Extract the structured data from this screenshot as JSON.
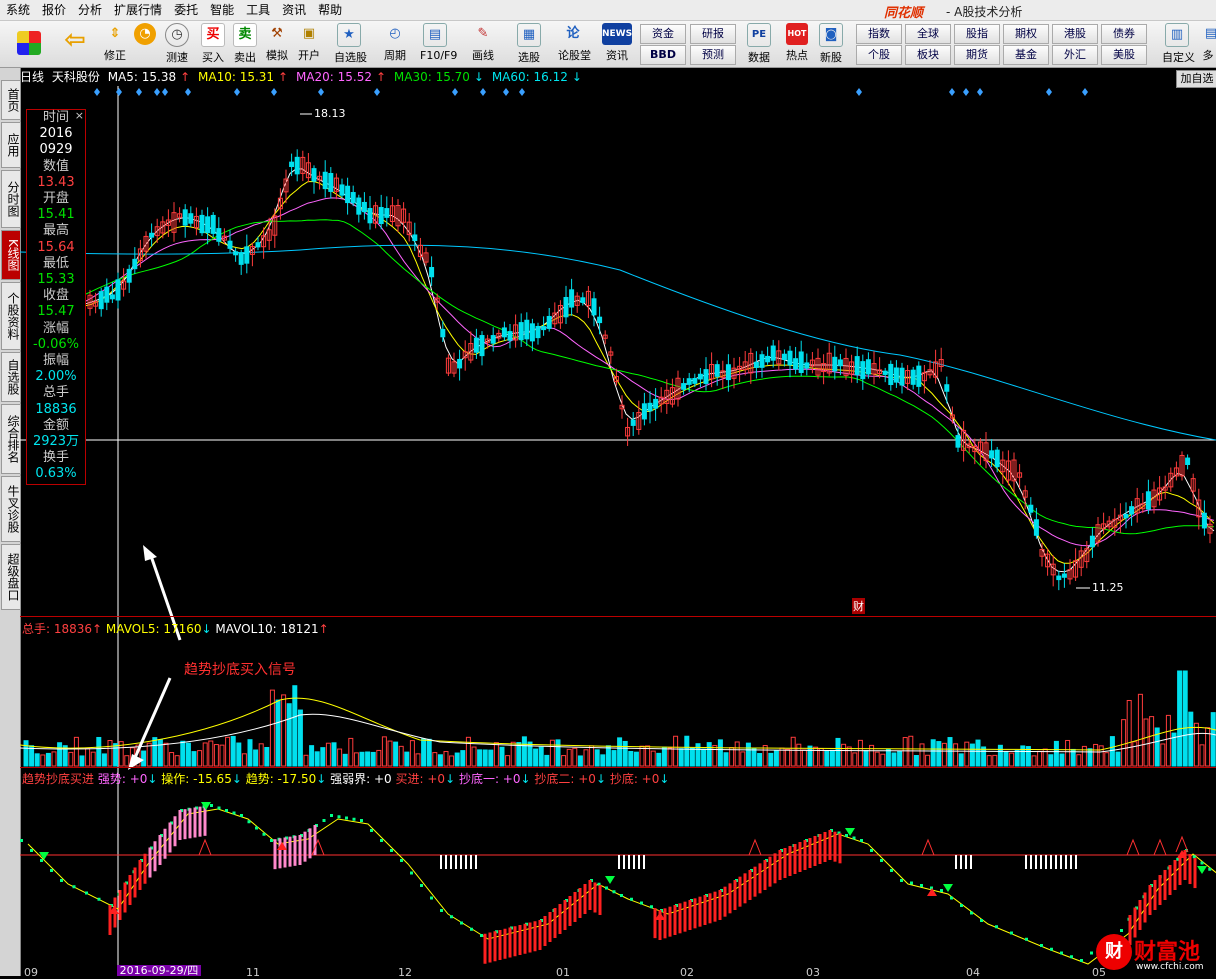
{
  "menu": [
    "系统",
    "报价",
    "分析",
    "扩展行情",
    "委托",
    "智能",
    "工具",
    "资讯",
    "帮助"
  ],
  "brand": "同花顺",
  "app_title": "- A股技术分析",
  "toolbar": {
    "buttons": [
      {
        "label": "",
        "icon": "grid-icon"
      },
      {
        "label": "",
        "icon": "back-arrow-icon"
      },
      {
        "label": "修正",
        "icon": "up-down-arrow-icon"
      },
      {
        "label": "测速",
        "icon": "clock-icon"
      },
      {
        "label": "买入",
        "icon": "buy-icon",
        "glyph": "买"
      },
      {
        "label": "卖出",
        "icon": "sell-icon",
        "glyph": "卖"
      },
      {
        "label": "模拟",
        "icon": "hammer-icon"
      },
      {
        "label": "开户",
        "icon": "lock-icon"
      },
      {
        "label": "自选股",
        "icon": "star-icon"
      },
      {
        "label": "周期",
        "icon": "cycle-icon"
      },
      {
        "label": "F10/F9",
        "icon": "f10-icon"
      },
      {
        "label": "画线",
        "icon": "pen-icon"
      },
      {
        "label": "选股",
        "icon": "screen-icon"
      },
      {
        "label": "论股堂",
        "icon": "forum-icon"
      },
      {
        "label": "资讯",
        "icon": "news-icon",
        "glyph": "NEWS"
      },
      {
        "label": "数据",
        "icon": "pe-icon",
        "glyph": "PE"
      },
      {
        "label": "热点",
        "icon": "hot-icon",
        "glyph": "HOT"
      },
      {
        "label": "新股",
        "icon": "new-stock-icon"
      },
      {
        "label": "自定义",
        "icon": "custom-icon"
      },
      {
        "label": "多",
        "icon": "more-icon"
      }
    ],
    "small": [
      "资金",
      "BBD",
      "研报",
      "预测",
      "指数",
      "个股",
      "全球",
      "板块",
      "股指",
      "期货",
      "期权",
      "基金",
      "港股",
      "外汇",
      "债券",
      "美股"
    ]
  },
  "sidebar_tabs": [
    "首页",
    "应用",
    "分时图",
    "K线图",
    "个股资料",
    "自选股",
    "综合排名",
    "牛叉诊股",
    "超级盘口"
  ],
  "add_self": "加自选",
  "kline_info": {
    "period": "日线",
    "stock": "天科股份",
    "ma5": "MA5: 15.38",
    "ma10": "MA10: 15.31",
    "ma20": "MA20: 15.52",
    "ma30": "MA30: 15.70",
    "ma60": "MA60: 16.12"
  },
  "data_window": {
    "time_label": "时间",
    "date_year": "2016",
    "date_md": "0929",
    "value_label": "数值",
    "value": "13.43",
    "open_label": "开盘",
    "open": "15.41",
    "high_label": "最高",
    "high": "15.64",
    "low_label": "最低",
    "low": "15.33",
    "close_label": "收盘",
    "close": "15.47",
    "change_label": "涨幅",
    "change": "-0.06%",
    "amplitude_label": "振幅",
    "amplitude": "2.00%",
    "volume_label": "总手",
    "volume": "18836",
    "amount_label": "金额",
    "amount": "2923万",
    "turnover_label": "换手",
    "turnover": "0.63%"
  },
  "price_marks": {
    "high": "18.13",
    "low": "11.25",
    "finance": "财"
  },
  "volume_info": {
    "total": "总手: 18836",
    "mavol5": "MAVOL5: 17160",
    "mavol10": "MAVOL10: 18121"
  },
  "indicator_info": {
    "name": "趋势抄底买进",
    "strong": "强势: +0",
    "op": "操作: -15.65",
    "trend": "趋势: -17.50",
    "bound": "强弱界: +0",
    "buy": "买进: +0",
    "bottom1": "抄底一: +0",
    "bottom2": "抄底二: +0",
    "bottom": "抄底: +0"
  },
  "annotation": "趋势抄底买入信号",
  "x_labels": [
    "09",
    "11",
    "12",
    "01",
    "02",
    "03",
    "04",
    "05"
  ],
  "cursor_date": "2016-09-29/四",
  "watermark": {
    "logo": "财",
    "text": "财富池",
    "url": "www.cfchi.com"
  },
  "colors": {
    "up": "#ff3c3c",
    "down": "#00e0ee",
    "ma5": "#ffffff",
    "ma10": "#ffff00",
    "ma20": "#ff66ff",
    "ma30": "#00ff00",
    "ma60": "#00c8ff"
  }
}
